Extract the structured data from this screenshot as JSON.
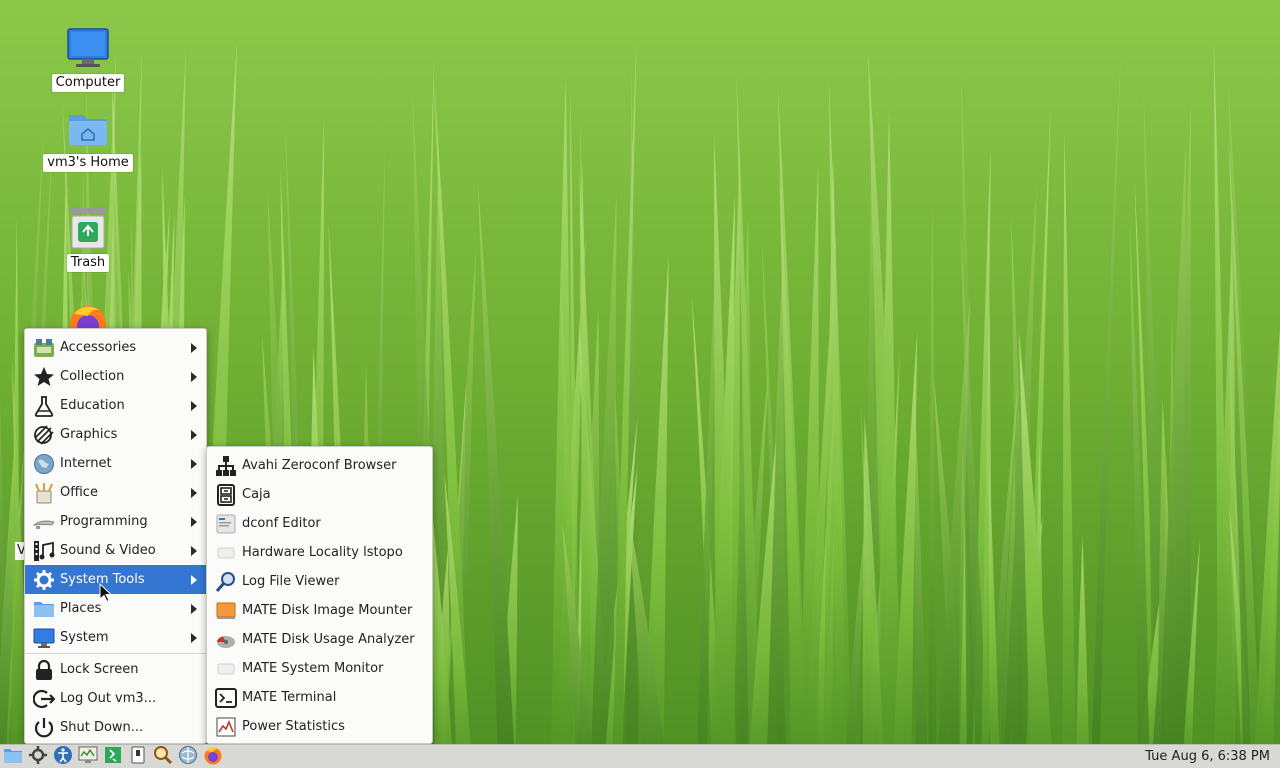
{
  "desktop": {
    "icons": [
      {
        "label": "Computer",
        "icon": "computer-icon"
      },
      {
        "label": "vm3's Home",
        "icon": "home-folder-icon"
      },
      {
        "label": "Trash",
        "icon": "trash-icon"
      },
      {
        "label": "",
        "icon": "firefox-icon"
      }
    ],
    "stray_label": "V"
  },
  "main_menu": {
    "items": [
      {
        "label": "Accessories",
        "icon": "accessories-icon",
        "submenu": true
      },
      {
        "label": "Collection",
        "icon": "star-icon",
        "submenu": true
      },
      {
        "label": "Education",
        "icon": "flask-icon",
        "submenu": true
      },
      {
        "label": "Graphics",
        "icon": "graphics-icon",
        "submenu": true
      },
      {
        "label": "Internet",
        "icon": "globe-icon",
        "submenu": true
      },
      {
        "label": "Office",
        "icon": "office-icon",
        "submenu": true
      },
      {
        "label": "Programming",
        "icon": "programming-icon",
        "submenu": true
      },
      {
        "label": "Sound & Video",
        "icon": "sound-video-icon",
        "submenu": true
      },
      {
        "label": "System Tools",
        "icon": "gear-icon",
        "submenu": true,
        "active": true
      },
      {
        "label": "Places",
        "icon": "folder-icon",
        "submenu": true
      },
      {
        "label": "System",
        "icon": "monitor-icon",
        "submenu": true
      }
    ],
    "actions": [
      {
        "label": "Lock Screen",
        "icon": "lock-icon"
      },
      {
        "label": "Log Out vm3...",
        "icon": "logout-icon"
      },
      {
        "label": "Shut Down...",
        "icon": "power-icon"
      }
    ]
  },
  "sub_menu": {
    "items": [
      {
        "label": "Avahi Zeroconf Browser",
        "icon": "network-tree-icon"
      },
      {
        "label": "Caja",
        "icon": "file-cabinet-icon"
      },
      {
        "label": "dconf Editor",
        "icon": "dconf-icon"
      },
      {
        "label": "Hardware Locality lstopo",
        "icon": "hardware-icon"
      },
      {
        "label": "Log File Viewer",
        "icon": "magnifier-icon"
      },
      {
        "label": "MATE Disk Image Mounter",
        "icon": "disk-image-icon"
      },
      {
        "label": "MATE Disk Usage Analyzer",
        "icon": "disk-usage-icon"
      },
      {
        "label": "MATE System Monitor",
        "icon": "system-monitor-icon"
      },
      {
        "label": "MATE Terminal",
        "icon": "terminal-icon"
      },
      {
        "label": "Power Statistics",
        "icon": "power-stats-icon"
      }
    ]
  },
  "panel": {
    "launchers": [
      "show-desktop-icon",
      "settings-icon",
      "accessibility-icon",
      "system-monitor-icon",
      "exit-icon",
      "device-icon",
      "search-icon",
      "network-icon",
      "firefox-icon"
    ],
    "clock": "Tue Aug  6,  6:38 PM"
  },
  "colors": {
    "menu_highlight": "#3476d2",
    "panel_bg": "#d8d8d5",
    "menu_bg": "#fbfbfa"
  }
}
